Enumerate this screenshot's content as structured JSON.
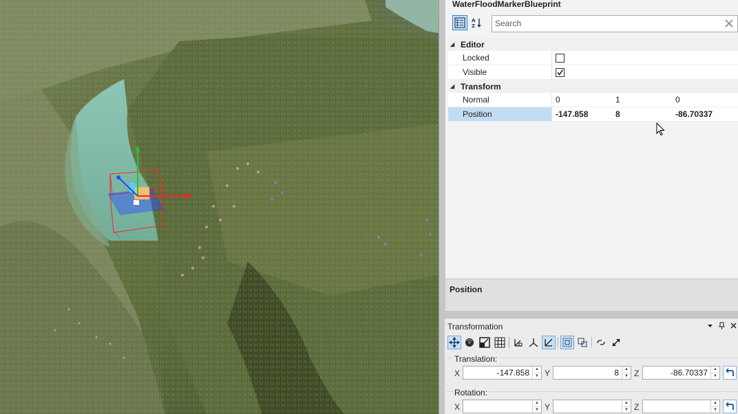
{
  "properties_panel": {
    "title": "WaterFloodMarkerBlueprint",
    "search": {
      "placeholder": "Search",
      "value": ""
    },
    "categories": [
      {
        "name": "Editor",
        "properties": [
          {
            "name": "Locked",
            "checked": false
          },
          {
            "name": "Visible",
            "checked": true
          }
        ]
      },
      {
        "name": "Transform",
        "properties": [
          {
            "name": "Normal",
            "values": [
              "0",
              "1",
              "0"
            ]
          },
          {
            "name": "Position",
            "values": [
              "-147.858",
              "8",
              "-86.70337"
            ],
            "selected": true
          }
        ]
      }
    ],
    "description_title": "Position"
  },
  "transformation_panel": {
    "title": "Transformation",
    "translation": {
      "label": "Translation:",
      "x_label": "X",
      "y_label": "Y",
      "z_label": "Z",
      "x": "-147.858",
      "y": "8",
      "z": "-86.70337"
    },
    "rotation": {
      "label": "Rotation:",
      "x_label": "X",
      "y_label": "Y",
      "z_label": "Z",
      "x": "",
      "y": "",
      "z": ""
    }
  },
  "colors": {
    "accent": "#3c7fc1",
    "selection": "#c0ddf3",
    "gizmo_x": "#ff2020",
    "gizmo_y": "#20c040",
    "gizmo_z": "#2050ff"
  },
  "icons": [
    "categorized-view-icon",
    "alphabetical-sort-icon",
    "clear-search-icon",
    "move-icon",
    "rotate-icon",
    "scale-icon",
    "grid-snap-icon",
    "pin-icon",
    "close-icon",
    "dropdown-icon",
    "reset-icon",
    "cursor-icon"
  ]
}
